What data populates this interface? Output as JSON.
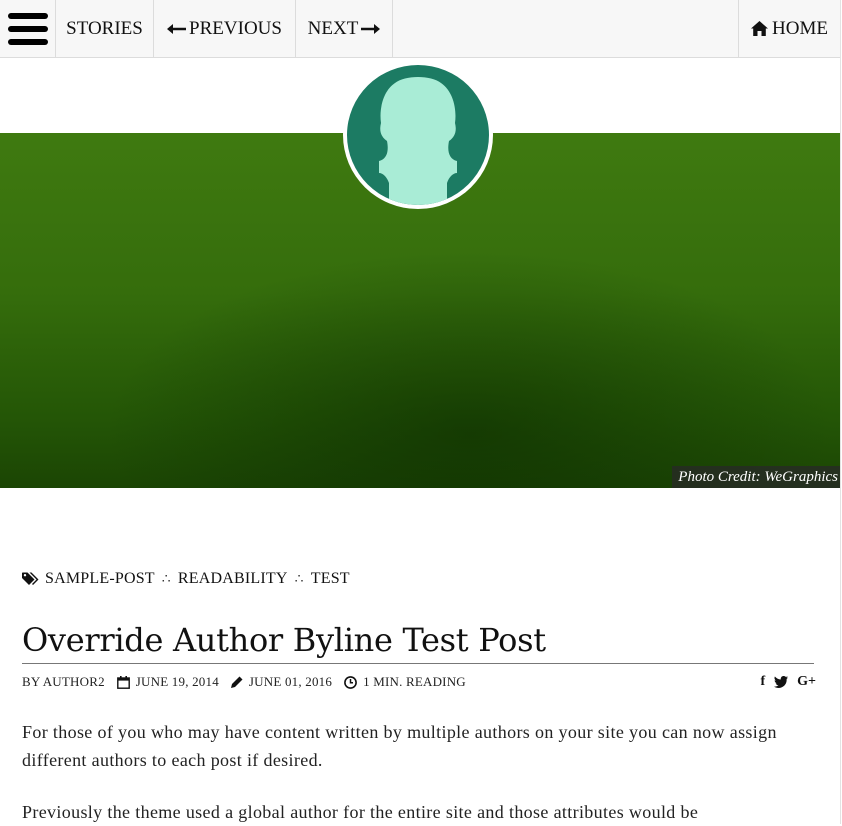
{
  "nav": {
    "stories": "STORIES",
    "previous": "PREVIOUS",
    "next": "NEXT",
    "home": "HOME",
    "icons": [
      "hamburger-menu-icon",
      "arrow-left-icon",
      "arrow-right-icon",
      "home-icon"
    ]
  },
  "hero": {
    "photo_credit": "Photo Credit: WeGraphics",
    "colors": {
      "hero_green": "#3f7a10",
      "avatar_bg": "#1c7b63",
      "avatar_silhouette": "#a9ecd6"
    }
  },
  "post": {
    "tags": [
      "SAMPLE-POST",
      "READABILITY",
      "TEST"
    ],
    "tag_separator": "∴",
    "title": "Override Author Byline Test Post",
    "meta": {
      "author": "BY AUTHOR2",
      "published": "JUNE 19, 2014",
      "updated": "JUNE 01, 2016",
      "reading_time": "1 MIN. READING"
    },
    "share": [
      "f",
      "twitter",
      "G+"
    ],
    "paragraphs": [
      "For those of you who may have content written by multiple authors on your site you can now assign different authors to each post if desired.",
      "Previously the theme used a global author for the entire site and those attributes would be"
    ]
  }
}
